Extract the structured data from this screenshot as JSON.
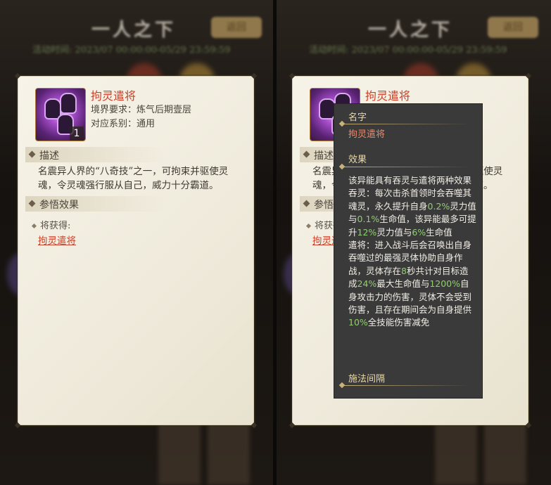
{
  "background": {
    "title": "一人之下",
    "button_label": "返回",
    "time_text": "活动时间: 2023/07 00:00:00-05/29 23:59:59"
  },
  "item": {
    "name": "拘灵遣将",
    "count": "1",
    "realm_req": "境界要求：炼气后期壹层",
    "series": "对应系别：通用",
    "icon": "purple-ghost-spirits-icon"
  },
  "sections": {
    "desc_title": "描述",
    "desc_text": "名震异人界的“八奇技”之一，可拘束并驱使灵魂，令灵魂强行服从自己，威力十分霸道。",
    "effect_title": "参悟效果",
    "obtain_label": "将获得:",
    "obtain_link": "拘灵遣将"
  },
  "tooltip": {
    "name_header": "名字",
    "name_value": "拘灵遣将",
    "effect_header": "效果",
    "effect_intro": "该异能具有吞灵与遣将两种效果",
    "tunling_a": "吞灵：每次击杀首领时会吞噬其魂灵，永久提升自身",
    "tunling_v1": "0.2%",
    "tunling_b": "灵力值与",
    "tunling_v2": "0.1%",
    "tunling_c": "生命值，该异能最多可提升",
    "tunling_v3": "12%",
    "tunling_d": "灵力值与",
    "tunling_v4": "6%",
    "tunling_e": "生命值",
    "qianjiang_a": "遣将：进入战斗后会召唤出自身吞噬过的最强灵体协助自身作战，灵体存在",
    "qianjiang_v1": "8",
    "qianjiang_b": "秒共计对目标造成",
    "qianjiang_v2": "24%",
    "qianjiang_c": "最大生命值与",
    "qianjiang_v3": "1200%",
    "qianjiang_d": "自身攻击力的伤害，灵体不会受到伤害，且存在期间会为自身提供",
    "qianjiang_v4": "10%",
    "qianjiang_e": "全技能伤害减免",
    "interval_header": "施法间隔"
  },
  "colors": {
    "accent_red": "#c9432c",
    "highlight_green": "#8fd06a",
    "tooltip_bg": "#3a3a3b"
  }
}
